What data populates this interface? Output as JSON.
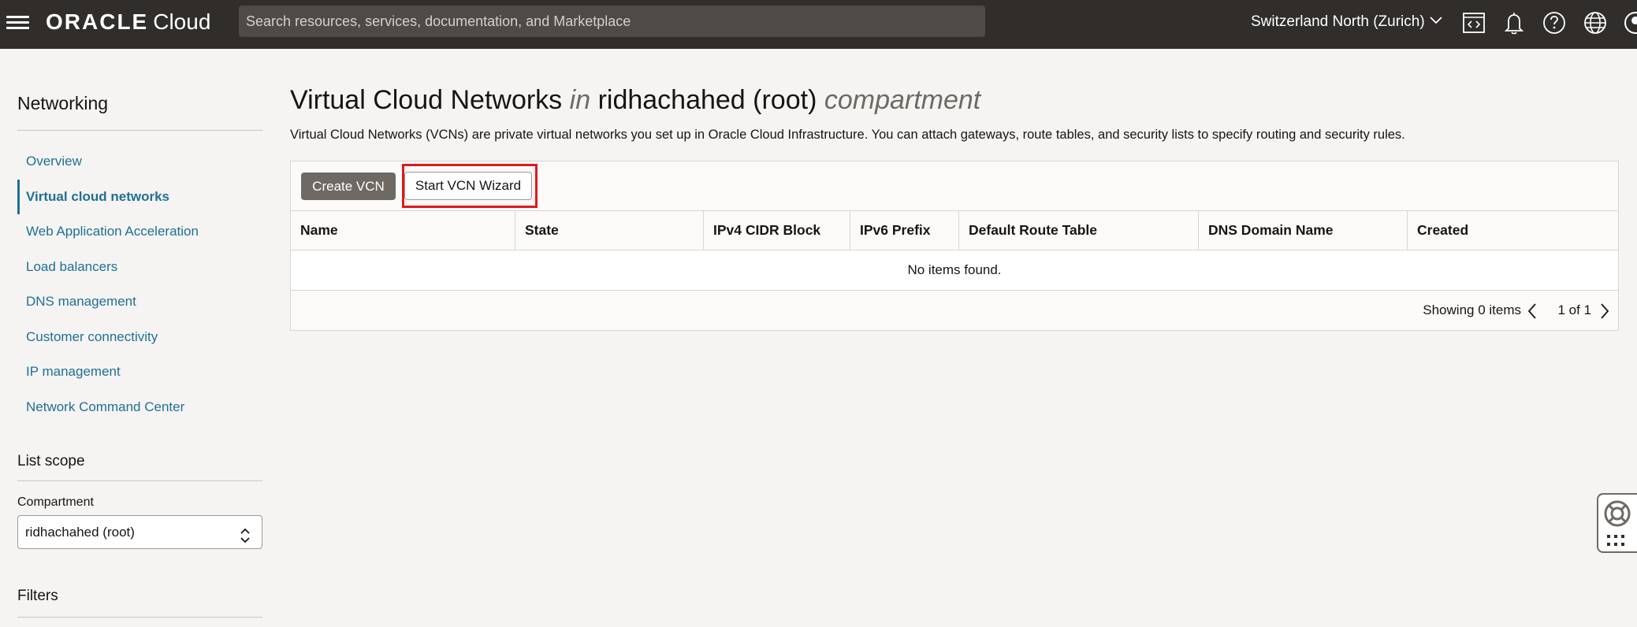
{
  "topbar": {
    "logo_oracle": "ORACLE",
    "logo_cloud": "Cloud",
    "search_placeholder": "Search resources, services, documentation, and Marketplace",
    "region": "Switzerland North (Zurich)"
  },
  "sidebar": {
    "title": "Networking",
    "items": [
      {
        "label": "Overview"
      },
      {
        "label": "Virtual cloud networks"
      },
      {
        "label": "Web Application Acceleration"
      },
      {
        "label": "Load balancers"
      },
      {
        "label": "DNS management"
      },
      {
        "label": "Customer connectivity"
      },
      {
        "label": "IP management"
      },
      {
        "label": "Network Command Center"
      }
    ],
    "active_index": 1,
    "list_scope_title": "List scope",
    "compartment_label": "Compartment",
    "compartment_value": "ridhachahed (root)",
    "filters_title": "Filters"
  },
  "main": {
    "title_part1": "Virtual Cloud Networks",
    "title_in": "in",
    "title_part2": "ridhachahed (root)",
    "title_compartment": "compartment",
    "description": "Virtual Cloud Networks (VCNs) are private virtual networks you set up in Oracle Cloud Infrastructure. You can attach gateways, route tables, and security lists to specify routing and security rules.",
    "create_button": "Create VCN",
    "wizard_button": "Start VCN Wizard",
    "columns": [
      "Name",
      "State",
      "IPv4 CIDR Block",
      "IPv6 Prefix",
      "Default Route Table",
      "DNS Domain Name",
      "Created"
    ],
    "empty_text": "No items found.",
    "showing_text": "Showing 0 items",
    "page_text": "1 of 1"
  },
  "colors": {
    "topbar": "#312d2a",
    "link": "#1f6f98",
    "highlight": "#e0191b"
  }
}
